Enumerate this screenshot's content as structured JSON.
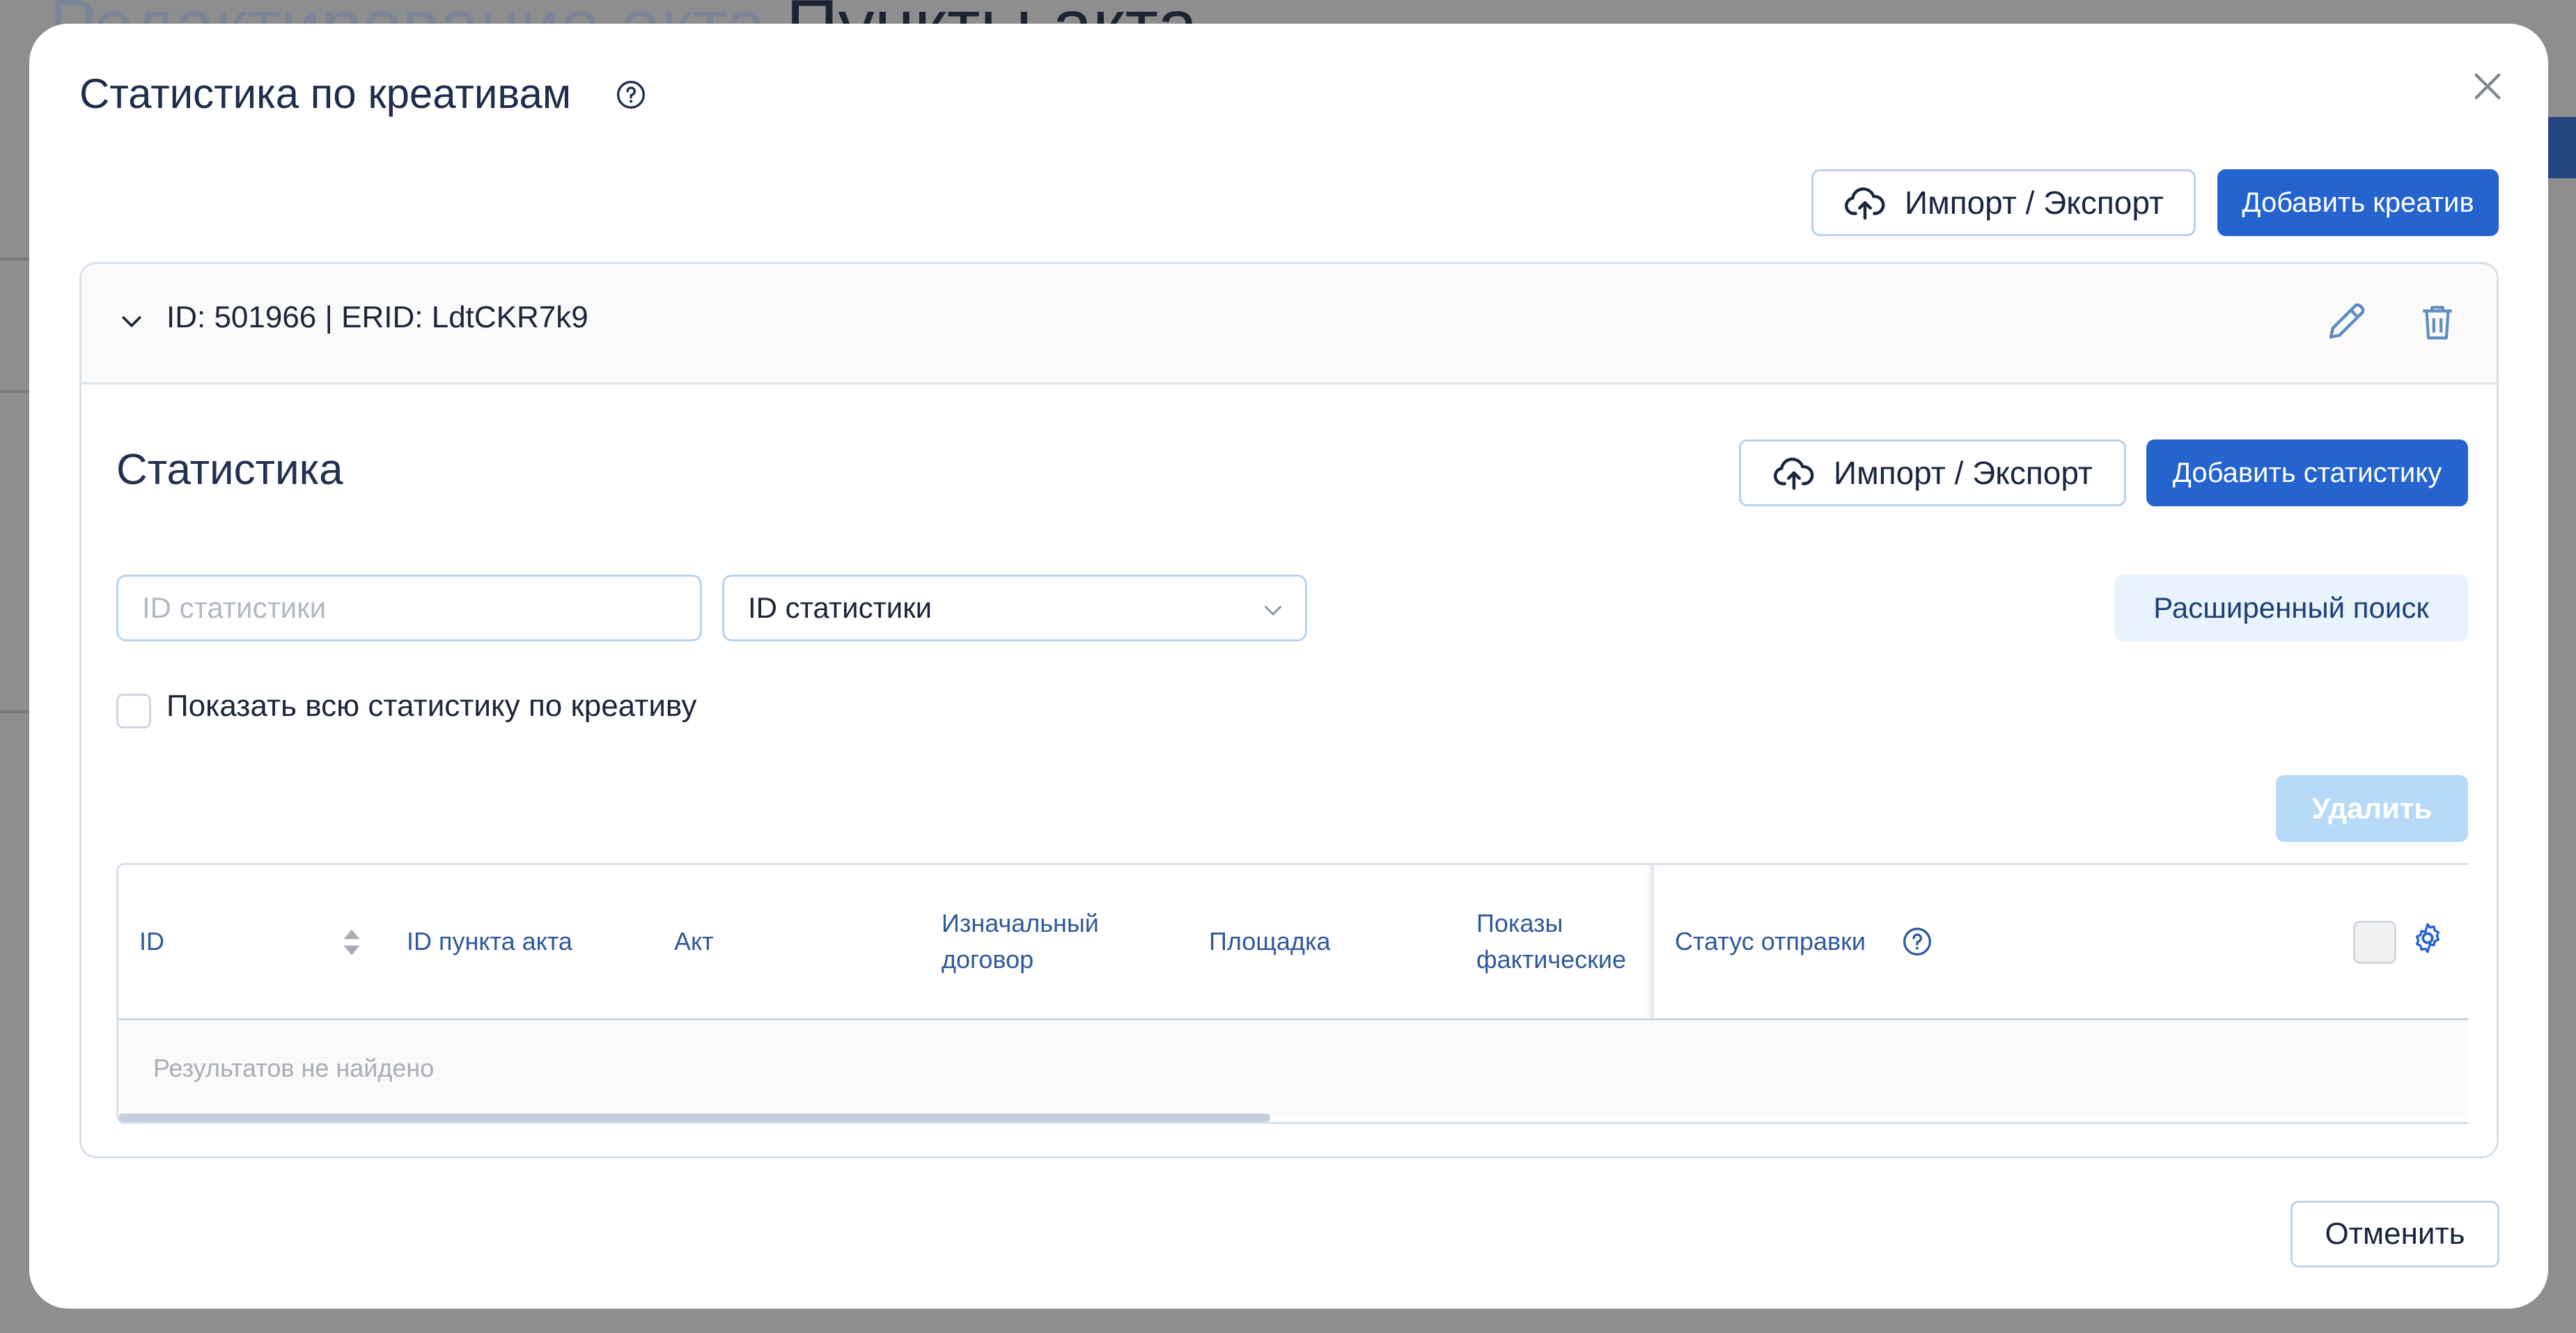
{
  "background": {
    "title_muted": "Редактирование акта",
    "title_dark": "Пункты акта"
  },
  "modal": {
    "title": "Статистика по креативам",
    "toolbar": {
      "import_export_label": "Импорт / Экспорт",
      "add_creative_label": "Добавить креатив"
    },
    "creative": {
      "header": "ID: 501966 | ERID: LdtCKR7k9",
      "statistics": {
        "title": "Статистика",
        "import_export_label": "Импорт / Экспорт",
        "add_statistics_label": "Добавить статистику",
        "search_placeholder": "ID статистики",
        "search_field_selected": "ID статистики",
        "advanced_search_label": "Расширенный поиск",
        "show_all_label": "Показать всю статистику по креативу",
        "delete_label": "Удалить",
        "table": {
          "columns": [
            "ID",
            "ID пункта акта",
            "Акт",
            "Изначальный договор",
            "Площадка",
            "Показы фактические",
            "Статус отправки"
          ],
          "empty_text": "Результатов не найдено"
        }
      }
    },
    "cancel_label": "Отменить"
  },
  "colors": {
    "primary": "#2563cf",
    "overlay": "#8e8e8e",
    "disabled": "#b6daf8",
    "header_text": "#2d5a9b"
  },
  "icons": [
    "help-icon",
    "close-icon",
    "upload-cloud-icon",
    "chevron-down-icon",
    "edit-pencil-icon",
    "trash-icon",
    "sort-icon",
    "gear-icon"
  ]
}
